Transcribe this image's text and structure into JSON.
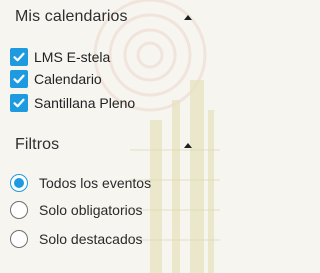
{
  "calendars": {
    "title": "Mis calendarios",
    "collapse_icon": "caret-up",
    "items": [
      {
        "label": "LMS E-stela",
        "checked": true
      },
      {
        "label": "Calendario",
        "checked": true
      },
      {
        "label": "Santillana Pleno",
        "checked": true
      }
    ]
  },
  "filters": {
    "title": "Filtros",
    "collapse_icon": "caret-up",
    "options": [
      {
        "label": "Todos los eventos",
        "selected": true
      },
      {
        "label": "Solo obligatorios",
        "selected": false
      },
      {
        "label": "Solo destacados",
        "selected": false
      }
    ]
  },
  "colors": {
    "accent": "#1e9be0",
    "background": "#f7f5f0",
    "decoration": "#d9d4a8"
  }
}
